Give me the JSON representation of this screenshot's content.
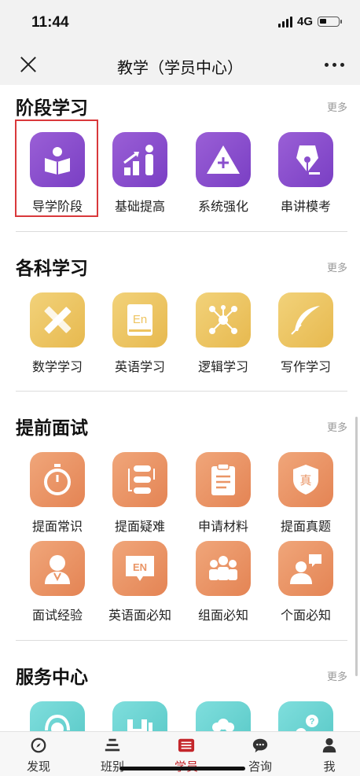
{
  "status": {
    "time": "11:44",
    "network": "4G"
  },
  "nav": {
    "title": "教学（学员中心）"
  },
  "sections": [
    {
      "title": "阶段学习",
      "more": "更多",
      "items": [
        {
          "label": "导学阶段",
          "icon": "reading-person-icon"
        },
        {
          "label": "基础提高",
          "icon": "growth-chart-icon"
        },
        {
          "label": "系统强化",
          "icon": "plus-triangle-icon"
        },
        {
          "label": "串讲模考",
          "icon": "pen-nib-icon"
        }
      ]
    },
    {
      "title": "各科学习",
      "more": "更多",
      "items": [
        {
          "label": "数学学习",
          "icon": "pencil-ruler-icon"
        },
        {
          "label": "英语学习",
          "icon": "english-book-icon",
          "badge": "En"
        },
        {
          "label": "逻辑学习",
          "icon": "molecule-icon"
        },
        {
          "label": "写作学习",
          "icon": "feather-icon"
        }
      ]
    },
    {
      "title": "提前面试",
      "more": "更多",
      "items": [
        {
          "label": "提面常识",
          "icon": "stopwatch-icon"
        },
        {
          "label": "提面疑难",
          "icon": "flow-icon"
        },
        {
          "label": "申请材料",
          "icon": "clipboard-icon"
        },
        {
          "label": "提面真题",
          "icon": "shield-icon",
          "badge": "真"
        },
        {
          "label": "面试经验",
          "icon": "interviewer-icon"
        },
        {
          "label": "英语面必知",
          "icon": "en-bubble-icon",
          "badge": "EN"
        },
        {
          "label": "组面必知",
          "icon": "group-icon"
        },
        {
          "label": "个面必知",
          "icon": "speaker-icon"
        }
      ]
    },
    {
      "title": "服务中心",
      "more": "更多",
      "items": [
        {
          "label": "",
          "icon": "headset-icon"
        },
        {
          "label": "",
          "icon": "h-logo-icon"
        },
        {
          "label": "",
          "icon": "people-icon"
        },
        {
          "label": "",
          "icon": "question-person-icon"
        }
      ]
    }
  ],
  "tabs": [
    {
      "label": "发现",
      "icon": "compass-icon"
    },
    {
      "label": "班别",
      "icon": "stack-icon"
    },
    {
      "label": "学员",
      "icon": "list-icon",
      "active": true
    },
    {
      "label": "咨询",
      "icon": "chat-icon"
    },
    {
      "label": "我",
      "icon": "user-icon"
    }
  ],
  "colors": {
    "accent": "#c4262b",
    "purple": "#8a4fcd",
    "yellow": "#eec460",
    "orange": "#ea9566",
    "teal": "#6ad4d2"
  }
}
